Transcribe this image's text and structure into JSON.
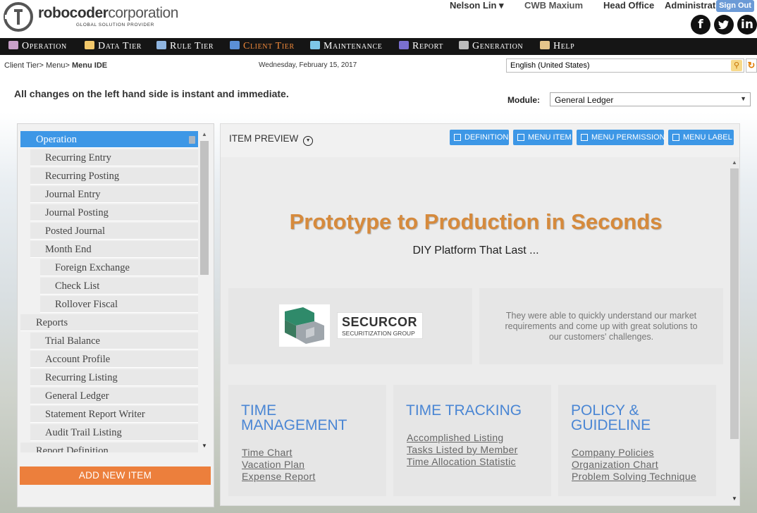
{
  "header": {
    "logo_name_bold": "robocoder",
    "logo_name_light": "corporation",
    "logo_tagline": "GLOBAL SOLUTION PROVIDER",
    "user_menu": "Nelson Lin ▾",
    "org": "CWB Maxium",
    "branch": "Head Office",
    "role": "Administration",
    "signout_label": "Sign Out",
    "social": {
      "facebook": "f",
      "twitter": "t",
      "linkedin": "in"
    }
  },
  "nav": [
    {
      "label": "Operation",
      "icon": "operation-icon",
      "color": "#c9a0c9"
    },
    {
      "label": "Data Tier",
      "icon": "data-tier-icon",
      "color": "#f2c86b"
    },
    {
      "label": "Rule Tier",
      "icon": "rule-tier-icon",
      "color": "#8fb5e0"
    },
    {
      "label": "Client Tier",
      "icon": "client-tier-icon",
      "color": "#5b8fd6",
      "active": true
    },
    {
      "label": "Maintenance",
      "icon": "maintenance-icon",
      "color": "#7ec7e8"
    },
    {
      "label": "Report",
      "icon": "report-icon",
      "color": "#7a6fd0"
    },
    {
      "label": "Generation",
      "icon": "generation-icon",
      "color": "#bbbbbb"
    },
    {
      "label": "Help",
      "icon": "help-icon",
      "color": "#e6c58a"
    }
  ],
  "breadcrumb": {
    "path": "Client Tier> Menu> ",
    "current": "Menu IDE"
  },
  "date": "Wednesday, February 15, 2017",
  "language": {
    "value": "English (United States)"
  },
  "notice": "All changes on the left hand side is instant and immediate.",
  "module": {
    "label": "Module:",
    "value": "General Ledger"
  },
  "tree": [
    {
      "label": "Operation",
      "level": 1,
      "selected": true
    },
    {
      "label": "Recurring Entry",
      "level": 2
    },
    {
      "label": "Recurring Posting",
      "level": 2
    },
    {
      "label": "Journal Entry",
      "level": 2
    },
    {
      "label": "Journal Posting",
      "level": 2
    },
    {
      "label": "Posted Journal",
      "level": 2
    },
    {
      "label": "Month End",
      "level": 2
    },
    {
      "label": "Foreign Exchange",
      "level": 3
    },
    {
      "label": "Check List",
      "level": 3
    },
    {
      "label": "Rollover Fiscal",
      "level": 3
    },
    {
      "label": "Reports",
      "level": 1
    },
    {
      "label": "Trial Balance",
      "level": 2
    },
    {
      "label": "Account Profile",
      "level": 2
    },
    {
      "label": "Recurring Listing",
      "level": 2
    },
    {
      "label": "General Ledger",
      "level": 2
    },
    {
      "label": "Statement Report Writer",
      "level": 2
    },
    {
      "label": "Audit Trail Listing",
      "level": 2
    },
    {
      "label": "Report Definition",
      "level": 1
    }
  ],
  "add_item_label": "ADD NEW ITEM",
  "preview": {
    "title": "ITEM PREVIEW",
    "toolbar": [
      "DEFINITION",
      "MENU ITEM",
      "MENU PERMISSION",
      "MENU LABEL"
    ],
    "hero_title": "Prototype to Production in Seconds",
    "hero_subtitle": "DIY Platform That Last ...",
    "client_name": "SECURCOR",
    "client_tagline": "SECURITIZATION GROUP",
    "quote": "They were able to quickly understand our market requirements and come up with great solutions to our customers' challenges.",
    "cards": [
      {
        "title_lines": [
          "TIME",
          "MANAGEMENT"
        ],
        "links": [
          "Time Chart",
          "Vacation Plan",
          "Expense Report"
        ]
      },
      {
        "title_lines": [
          "TIME TRACKING"
        ],
        "links": [
          "Accomplished Listing",
          "Tasks Listed by Member",
          "Time Allocation Statistic"
        ]
      },
      {
        "title_lines": [
          "POLICY &",
          "GUIDELINE"
        ],
        "links": [
          "Company Policies",
          "Organization Chart",
          "Problem Solving Technique"
        ]
      }
    ]
  }
}
